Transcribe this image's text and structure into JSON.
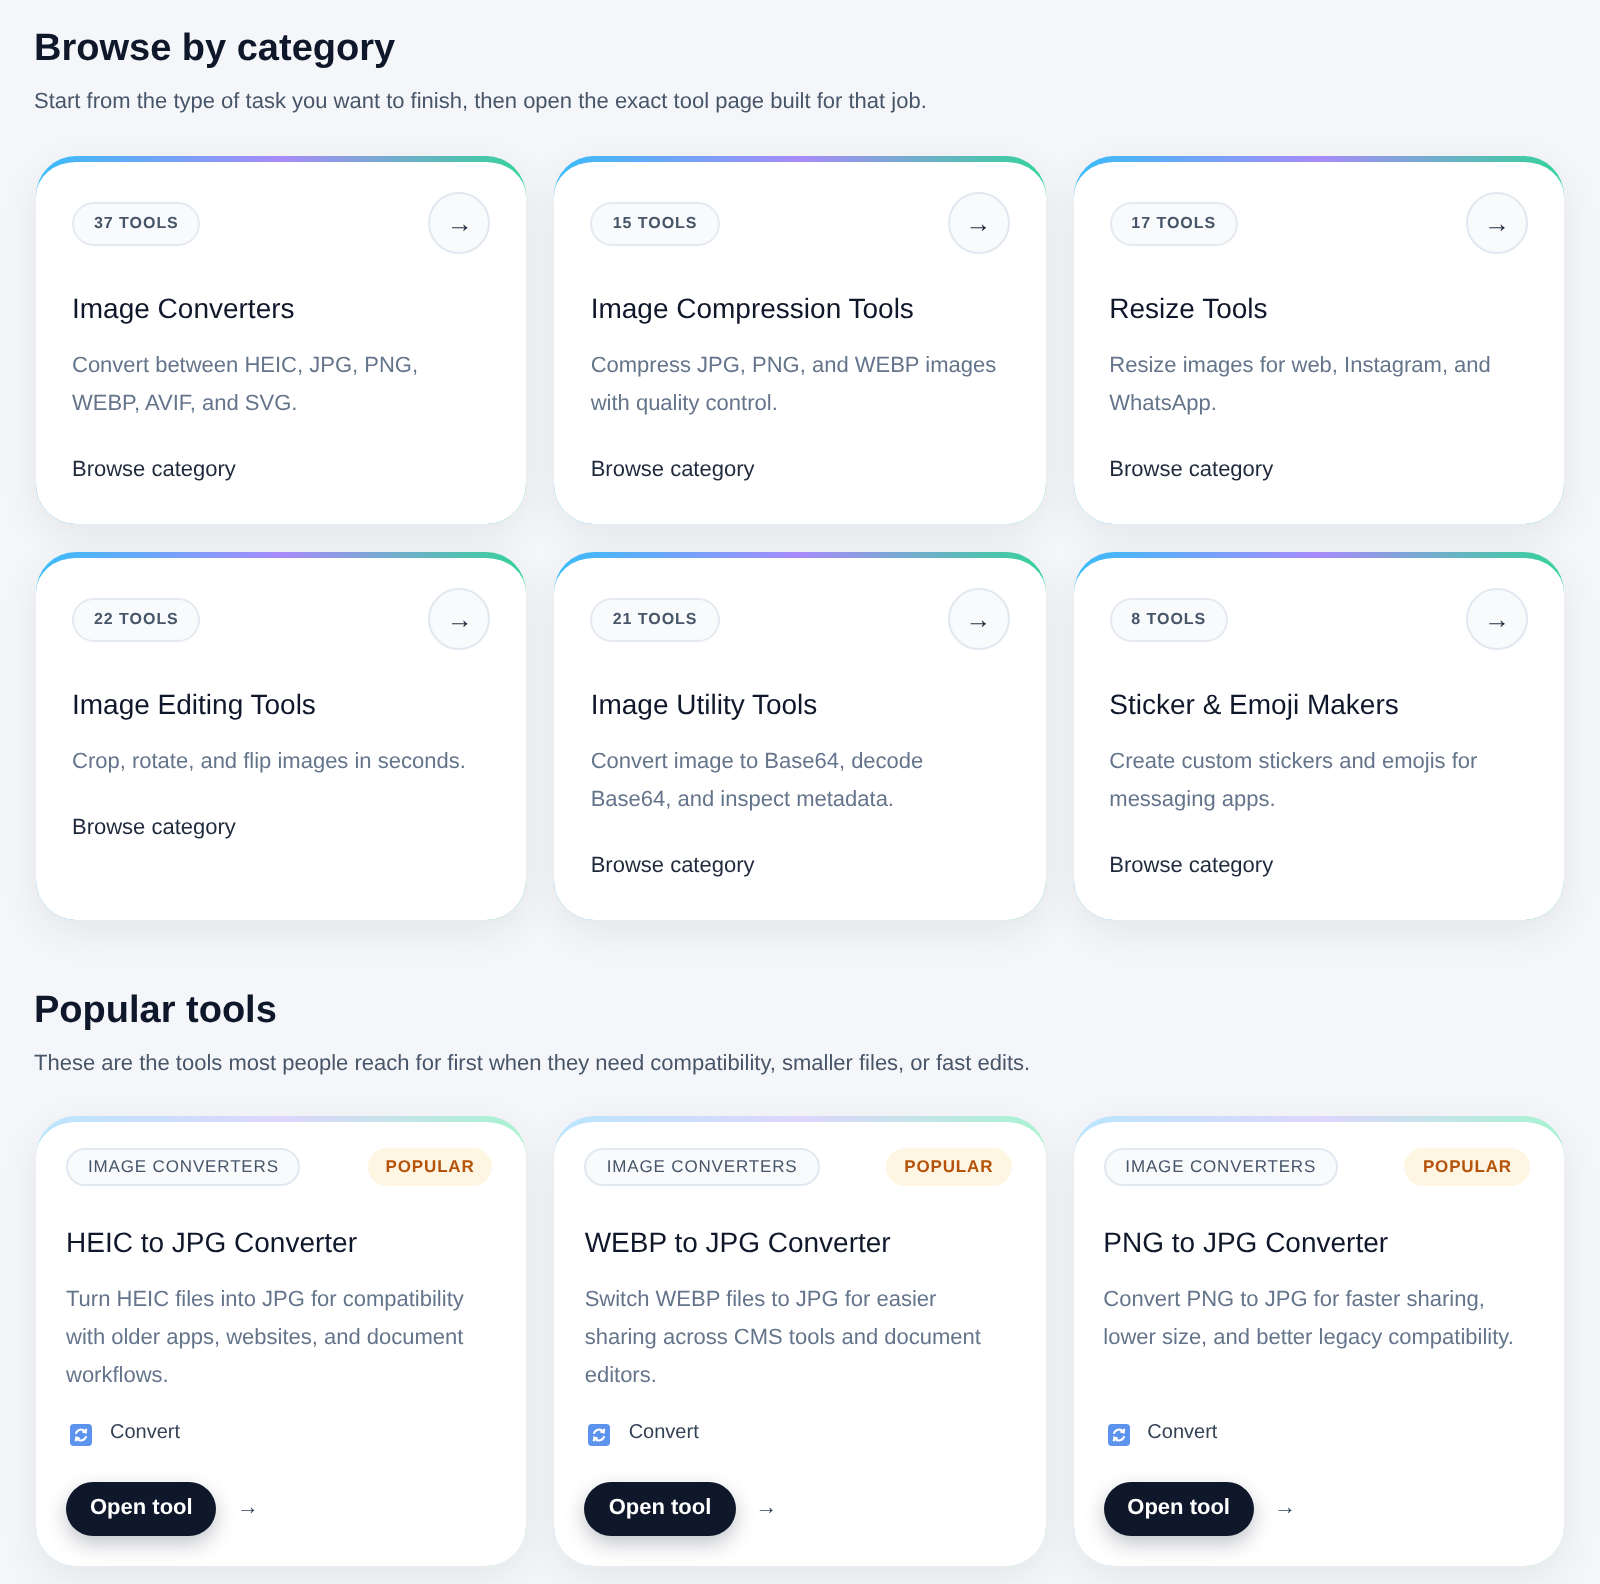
{
  "browse": {
    "title": "Browse by category",
    "subtitle": "Start from the type of task you want to finish, then open the exact tool page built for that job.",
    "categories": [
      {
        "count": "37 TOOLS",
        "arrow": "→",
        "title": "Image Converters",
        "description": "Convert between HEIC, JPG, PNG, WEBP, AVIF, and SVG.",
        "link": "Browse category"
      },
      {
        "count": "15 TOOLS",
        "arrow": "→",
        "title": "Image Compression Tools",
        "description": "Compress JPG, PNG, and WEBP images with quality control.",
        "link": "Browse category"
      },
      {
        "count": "17 TOOLS",
        "arrow": "→",
        "title": "Resize Tools",
        "description": "Resize images for web, Instagram, and WhatsApp.",
        "link": "Browse category"
      },
      {
        "count": "22 TOOLS",
        "arrow": "→",
        "title": "Image Editing Tools",
        "description": "Crop, rotate, and flip images in seconds.",
        "link": "Browse category"
      },
      {
        "count": "21 TOOLS",
        "arrow": "→",
        "title": "Image Utility Tools",
        "description": "Convert image to Base64, decode Base64, and inspect metadata.",
        "link": "Browse category"
      },
      {
        "count": "8 TOOLS",
        "arrow": "→",
        "title": "Sticker & Emoji Makers",
        "description": "Create custom stickers and emojis for messaging apps.",
        "link": "Browse category"
      }
    ]
  },
  "popular": {
    "title": "Popular tools",
    "subtitle": "These are the tools most people reach for first when they need compatibility, smaller files, or fast edits.",
    "tools": [
      {
        "category": "IMAGE CONVERTERS",
        "badge": "POPULAR",
        "title": "HEIC to JPG Converter",
        "description": "Turn HEIC files into JPG for compatibility with older apps, websites, and document workflows.",
        "action": "Convert",
        "button": "Open tool",
        "arrow": "→"
      },
      {
        "category": "IMAGE CONVERTERS",
        "badge": "POPULAR",
        "title": "WEBP to JPG Converter",
        "description": "Switch WEBP files to JPG for easier sharing across CMS tools and document editors.",
        "action": "Convert",
        "button": "Open tool",
        "arrow": "→"
      },
      {
        "category": "IMAGE CONVERTERS",
        "badge": "POPULAR",
        "title": "PNG to JPG Converter",
        "description": "Convert PNG to JPG for faster sharing, lower size, and better legacy compatibility.",
        "action": "Convert",
        "button": "Open tool",
        "arrow": "→"
      }
    ]
  }
}
